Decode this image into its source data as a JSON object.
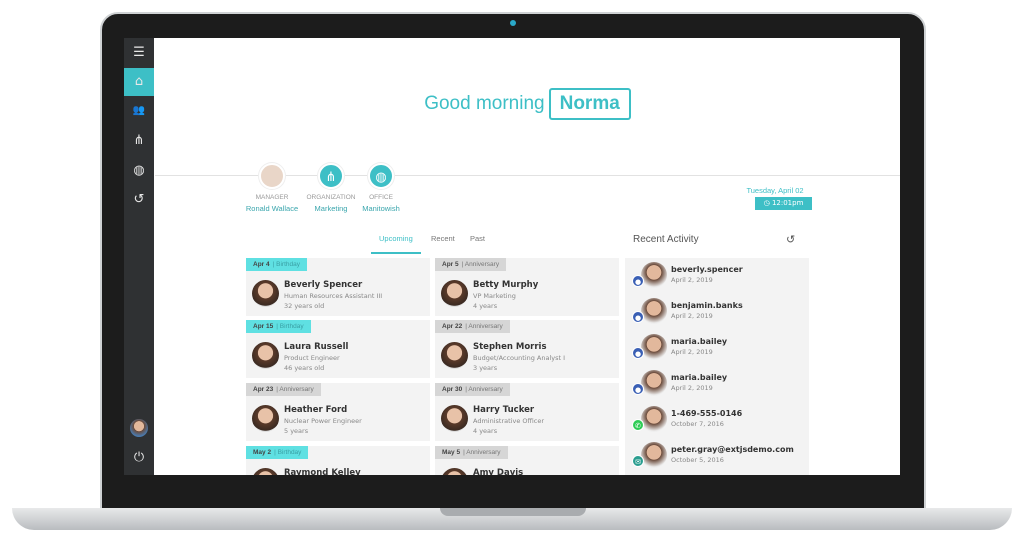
{
  "greeting": {
    "text": "Good morning",
    "name": "Norma"
  },
  "sidebar": {
    "items": [
      {
        "icon": "menu-icon",
        "glyph": "☰"
      },
      {
        "icon": "home-icon",
        "glyph": "⌂",
        "active": true
      },
      {
        "icon": "users-icon",
        "glyph": "👥"
      },
      {
        "icon": "sitemap-icon",
        "glyph": "⋔"
      },
      {
        "icon": "globe-icon",
        "glyph": "◍"
      },
      {
        "icon": "history-icon",
        "glyph": "↺"
      }
    ],
    "power": "⏻"
  },
  "info": [
    {
      "label": "MANAGER",
      "value": "Ronald Wallace"
    },
    {
      "label": "ORGANIZATION",
      "value": "Marketing"
    },
    {
      "label": "OFFICE",
      "value": "Manitowish"
    }
  ],
  "date": "Tuesday, April 02",
  "time": "12:01pm",
  "tabs": [
    "Upcoming",
    "Recent",
    "Past"
  ],
  "events": [
    {
      "date": "Apr 4",
      "kind": "Birthday",
      "name": "Beverly Spencer",
      "title": "Human Resources Assistant III",
      "detail": "32 years old"
    },
    {
      "date": "Apr 5",
      "kind": "Anniversary",
      "name": "Betty Murphy",
      "title": "VP Marketing",
      "detail": "4 years"
    },
    {
      "date": "Apr 15",
      "kind": "Birthday",
      "name": "Laura Russell",
      "title": "Product Engineer",
      "detail": "46 years old"
    },
    {
      "date": "Apr 22",
      "kind": "Anniversary",
      "name": "Stephen Morris",
      "title": "Budget/Accounting Analyst I",
      "detail": "3 years"
    },
    {
      "date": "Apr 23",
      "kind": "Anniversary",
      "name": "Heather Ford",
      "title": "Nuclear Power Engineer",
      "detail": "5 years"
    },
    {
      "date": "Apr 30",
      "kind": "Anniversary",
      "name": "Harry Tucker",
      "title": "Administrative Officer",
      "detail": "4 years"
    },
    {
      "date": "May 2",
      "kind": "Birthday",
      "name": "Raymond Kelley",
      "title": "",
      "detail": ""
    },
    {
      "date": "May 5",
      "kind": "Anniversary",
      "name": "Amy Davis",
      "title": "",
      "detail": ""
    }
  ],
  "activity": {
    "title": "Recent Activity",
    "items": [
      {
        "type": "user",
        "name": "beverly.spencer",
        "date": "April 2, 2019"
      },
      {
        "type": "user",
        "name": "benjamin.banks",
        "date": "April 2, 2019"
      },
      {
        "type": "user",
        "name": "maria.bailey",
        "date": "April 2, 2019"
      },
      {
        "type": "user",
        "name": "maria.bailey",
        "date": "April 2, 2019"
      },
      {
        "type": "phone",
        "name": "1-469-555-0146",
        "date": "October 7, 2016"
      },
      {
        "type": "email",
        "name": "peter.gray@extjsdemo.com",
        "date": "October 5, 2016"
      }
    ]
  },
  "colors": {
    "accent": "#3dbfc6",
    "sidebar": "#2f3133",
    "user_badge": "#3a5fb4",
    "phone_badge": "#2ecc55",
    "email_badge": "#2a9d8f"
  }
}
